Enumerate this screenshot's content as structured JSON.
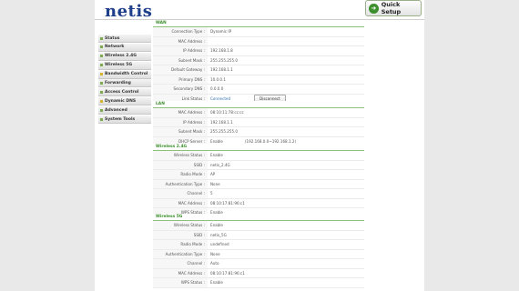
{
  "brand": {
    "logo": "netis"
  },
  "header": {
    "quick_setup": "Quick Setup"
  },
  "sidebar": {
    "items": [
      {
        "label": "Status",
        "color": "green"
      },
      {
        "label": "Network",
        "color": "green"
      },
      {
        "label": "Wireless 2.4G",
        "color": "green"
      },
      {
        "label": "Wireless 5G",
        "color": "green"
      },
      {
        "label": "Bandwidth Control",
        "color": "yellow"
      },
      {
        "label": "Forwarding",
        "color": "green"
      },
      {
        "label": "Access Control",
        "color": "green"
      },
      {
        "label": "Dynamic DNS",
        "color": "yellow"
      },
      {
        "label": "Advanced",
        "color": "green"
      },
      {
        "label": "System Tools",
        "color": "green"
      }
    ]
  },
  "wan": {
    "title": "WAN",
    "rows": [
      {
        "label": "Connection Type :",
        "value": "Dynamic IP"
      },
      {
        "label": "MAC Address :",
        "value": ""
      },
      {
        "label": "IP Address :",
        "value": "192.168.1.8"
      },
      {
        "label": "Subnet Mask :",
        "value": "255.255.255.0"
      },
      {
        "label": "Default Gateway :",
        "value": "192.168.1.1"
      },
      {
        "label": "Primary DNS :",
        "value": "10.0.0.1"
      },
      {
        "label": "Secondary DNS :",
        "value": "0.0.0.0"
      }
    ],
    "link_status_label": "Link Status :",
    "link_status_value": "Connected",
    "disconnect_label": "Disconnect"
  },
  "lan": {
    "title": "LAN",
    "rows": [
      {
        "label": "MAC Address :",
        "value": "08:10:11:78:cc:cc"
      },
      {
        "label": "IP Address :",
        "value": "192.168.1.1"
      },
      {
        "label": "Subnet Mask :",
        "value": "255.255.255.0"
      }
    ],
    "dhcp_label": "DHCP Server :",
    "dhcp_value": "Enable",
    "dhcp_range": "(192.168.0.0~192.168.1.2)"
  },
  "w24": {
    "title": "Wireless 2.4G",
    "rows": [
      {
        "label": "Wireless Status :",
        "value": "Enable"
      },
      {
        "label": "SSID :",
        "value": "netis_2.4G"
      },
      {
        "label": "Radio Mode :",
        "value": "AP"
      },
      {
        "label": "Authentication Type :",
        "value": "None"
      },
      {
        "label": "Channel :",
        "value": "5"
      },
      {
        "label": "MAC Address :",
        "value": "08:10:17:81:96:c1"
      },
      {
        "label": "WPS Status :",
        "value": "Enable"
      }
    ]
  },
  "w5": {
    "title": "Wireless 5G",
    "rows": [
      {
        "label": "Wireless Status :",
        "value": "Enable"
      },
      {
        "label": "SSID :",
        "value": "netis_5G"
      },
      {
        "label": "Radio Mode :",
        "value": "undefined"
      },
      {
        "label": "Authentication Type :",
        "value": "None"
      },
      {
        "label": "Channel :",
        "value": "Auto"
      },
      {
        "label": "MAC Address :",
        "value": "08:10:17:81:96:c1"
      },
      {
        "label": "WPS Status :",
        "value": "Enable"
      }
    ]
  }
}
